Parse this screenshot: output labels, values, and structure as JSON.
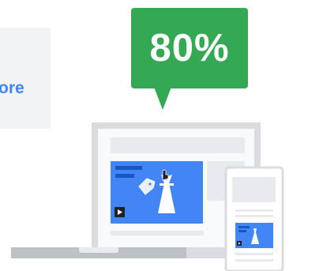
{
  "side_card": {
    "text": "ore"
  },
  "bubble": {
    "value": "80%"
  },
  "colors": {
    "accent_blue": "#4285f4",
    "bubble_green": "#34a853",
    "card_grey": "#f1f3f4",
    "device_grey": "#dadce0"
  },
  "icons": {
    "play": "play-icon",
    "tag": "price-tag-icon",
    "cursor": "hand-cursor-icon",
    "product": "dress-icon"
  }
}
